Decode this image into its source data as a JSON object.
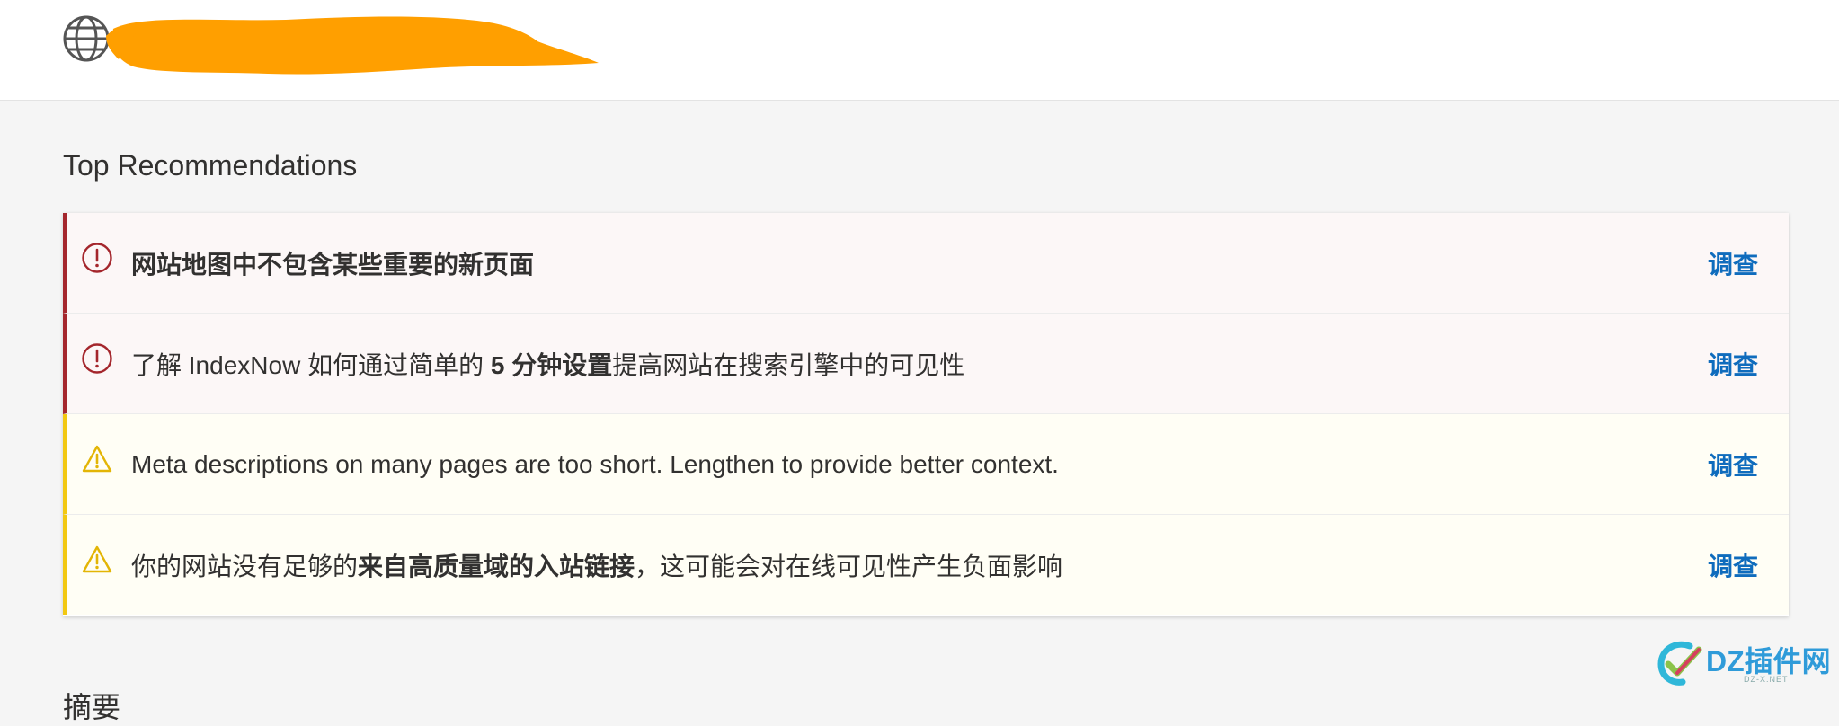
{
  "header": {
    "site_icon": "globe-icon"
  },
  "section": {
    "title": "Top Recommendations"
  },
  "recommendations": [
    {
      "severity": "error",
      "icon": "alert-circle-icon",
      "parts": [
        {
          "text": "网站地图中不包含某些重要的新页面",
          "bold": true
        }
      ],
      "action": "调查"
    },
    {
      "severity": "error",
      "icon": "alert-circle-icon",
      "parts": [
        {
          "text": "了解 IndexNow 如何通过简单的 ",
          "bold": false
        },
        {
          "text": "5 分钟设置",
          "bold": true
        },
        {
          "text": "提高网站在搜索引擎中的可见性",
          "bold": false
        }
      ],
      "action": "调查"
    },
    {
      "severity": "warning",
      "icon": "warning-triangle-icon",
      "parts": [
        {
          "text": "Meta descriptions on many pages are too short. Lengthen to provide better context.",
          "bold": false
        }
      ],
      "action": "调查"
    },
    {
      "severity": "warning",
      "icon": "warning-triangle-icon",
      "parts": [
        {
          "text": "你的网站没有足够的",
          "bold": false
        },
        {
          "text": "来自高质量域的入站链接",
          "bold": true
        },
        {
          "text": "，这可能会对在线可见性产生负面影响",
          "bold": false
        }
      ],
      "action": "调查"
    }
  ],
  "next_section": {
    "title": "摘要"
  },
  "watermark": {
    "logo_icon": "dz-check-logo-icon",
    "text": "DZ插件网",
    "sub": "DZ-X.NET"
  },
  "colors": {
    "error_accent": "#a4262c",
    "warning_accent": "#f2c811",
    "link": "#0f6cbd",
    "redaction": "#ff9f00"
  }
}
